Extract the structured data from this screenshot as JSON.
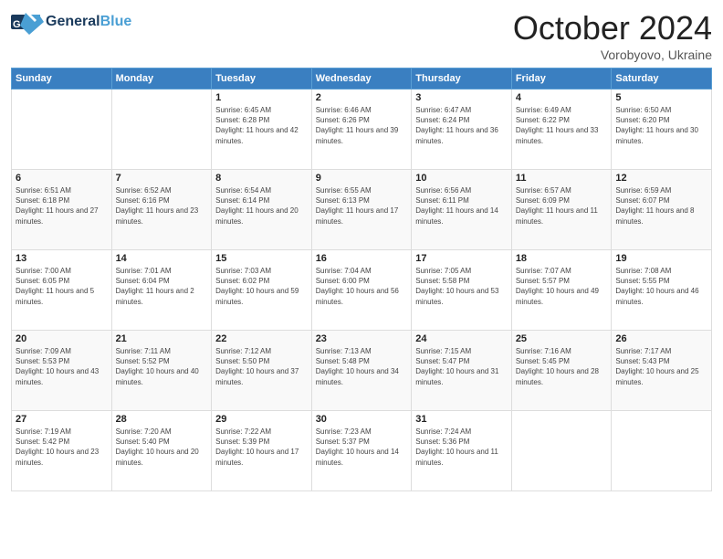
{
  "logo": {
    "general": "General",
    "blue": "Blue"
  },
  "title": {
    "month": "October 2024",
    "location": "Vorobyovo, Ukraine"
  },
  "days_of_week": [
    "Sunday",
    "Monday",
    "Tuesday",
    "Wednesday",
    "Thursday",
    "Friday",
    "Saturday"
  ],
  "weeks": [
    [
      {
        "day": "",
        "info": ""
      },
      {
        "day": "",
        "info": ""
      },
      {
        "day": "1",
        "info": "Sunrise: 6:45 AM\nSunset: 6:28 PM\nDaylight: 11 hours and 42 minutes."
      },
      {
        "day": "2",
        "info": "Sunrise: 6:46 AM\nSunset: 6:26 PM\nDaylight: 11 hours and 39 minutes."
      },
      {
        "day": "3",
        "info": "Sunrise: 6:47 AM\nSunset: 6:24 PM\nDaylight: 11 hours and 36 minutes."
      },
      {
        "day": "4",
        "info": "Sunrise: 6:49 AM\nSunset: 6:22 PM\nDaylight: 11 hours and 33 minutes."
      },
      {
        "day": "5",
        "info": "Sunrise: 6:50 AM\nSunset: 6:20 PM\nDaylight: 11 hours and 30 minutes."
      }
    ],
    [
      {
        "day": "6",
        "info": "Sunrise: 6:51 AM\nSunset: 6:18 PM\nDaylight: 11 hours and 27 minutes."
      },
      {
        "day": "7",
        "info": "Sunrise: 6:52 AM\nSunset: 6:16 PM\nDaylight: 11 hours and 23 minutes."
      },
      {
        "day": "8",
        "info": "Sunrise: 6:54 AM\nSunset: 6:14 PM\nDaylight: 11 hours and 20 minutes."
      },
      {
        "day": "9",
        "info": "Sunrise: 6:55 AM\nSunset: 6:13 PM\nDaylight: 11 hours and 17 minutes."
      },
      {
        "day": "10",
        "info": "Sunrise: 6:56 AM\nSunset: 6:11 PM\nDaylight: 11 hours and 14 minutes."
      },
      {
        "day": "11",
        "info": "Sunrise: 6:57 AM\nSunset: 6:09 PM\nDaylight: 11 hours and 11 minutes."
      },
      {
        "day": "12",
        "info": "Sunrise: 6:59 AM\nSunset: 6:07 PM\nDaylight: 11 hours and 8 minutes."
      }
    ],
    [
      {
        "day": "13",
        "info": "Sunrise: 7:00 AM\nSunset: 6:05 PM\nDaylight: 11 hours and 5 minutes."
      },
      {
        "day": "14",
        "info": "Sunrise: 7:01 AM\nSunset: 6:04 PM\nDaylight: 11 hours and 2 minutes."
      },
      {
        "day": "15",
        "info": "Sunrise: 7:03 AM\nSunset: 6:02 PM\nDaylight: 10 hours and 59 minutes."
      },
      {
        "day": "16",
        "info": "Sunrise: 7:04 AM\nSunset: 6:00 PM\nDaylight: 10 hours and 56 minutes."
      },
      {
        "day": "17",
        "info": "Sunrise: 7:05 AM\nSunset: 5:58 PM\nDaylight: 10 hours and 53 minutes."
      },
      {
        "day": "18",
        "info": "Sunrise: 7:07 AM\nSunset: 5:57 PM\nDaylight: 10 hours and 49 minutes."
      },
      {
        "day": "19",
        "info": "Sunrise: 7:08 AM\nSunset: 5:55 PM\nDaylight: 10 hours and 46 minutes."
      }
    ],
    [
      {
        "day": "20",
        "info": "Sunrise: 7:09 AM\nSunset: 5:53 PM\nDaylight: 10 hours and 43 minutes."
      },
      {
        "day": "21",
        "info": "Sunrise: 7:11 AM\nSunset: 5:52 PM\nDaylight: 10 hours and 40 minutes."
      },
      {
        "day": "22",
        "info": "Sunrise: 7:12 AM\nSunset: 5:50 PM\nDaylight: 10 hours and 37 minutes."
      },
      {
        "day": "23",
        "info": "Sunrise: 7:13 AM\nSunset: 5:48 PM\nDaylight: 10 hours and 34 minutes."
      },
      {
        "day": "24",
        "info": "Sunrise: 7:15 AM\nSunset: 5:47 PM\nDaylight: 10 hours and 31 minutes."
      },
      {
        "day": "25",
        "info": "Sunrise: 7:16 AM\nSunset: 5:45 PM\nDaylight: 10 hours and 28 minutes."
      },
      {
        "day": "26",
        "info": "Sunrise: 7:17 AM\nSunset: 5:43 PM\nDaylight: 10 hours and 25 minutes."
      }
    ],
    [
      {
        "day": "27",
        "info": "Sunrise: 7:19 AM\nSunset: 5:42 PM\nDaylight: 10 hours and 23 minutes."
      },
      {
        "day": "28",
        "info": "Sunrise: 7:20 AM\nSunset: 5:40 PM\nDaylight: 10 hours and 20 minutes."
      },
      {
        "day": "29",
        "info": "Sunrise: 7:22 AM\nSunset: 5:39 PM\nDaylight: 10 hours and 17 minutes."
      },
      {
        "day": "30",
        "info": "Sunrise: 7:23 AM\nSunset: 5:37 PM\nDaylight: 10 hours and 14 minutes."
      },
      {
        "day": "31",
        "info": "Sunrise: 7:24 AM\nSunset: 5:36 PM\nDaylight: 10 hours and 11 minutes."
      },
      {
        "day": "",
        "info": ""
      },
      {
        "day": "",
        "info": ""
      }
    ]
  ]
}
